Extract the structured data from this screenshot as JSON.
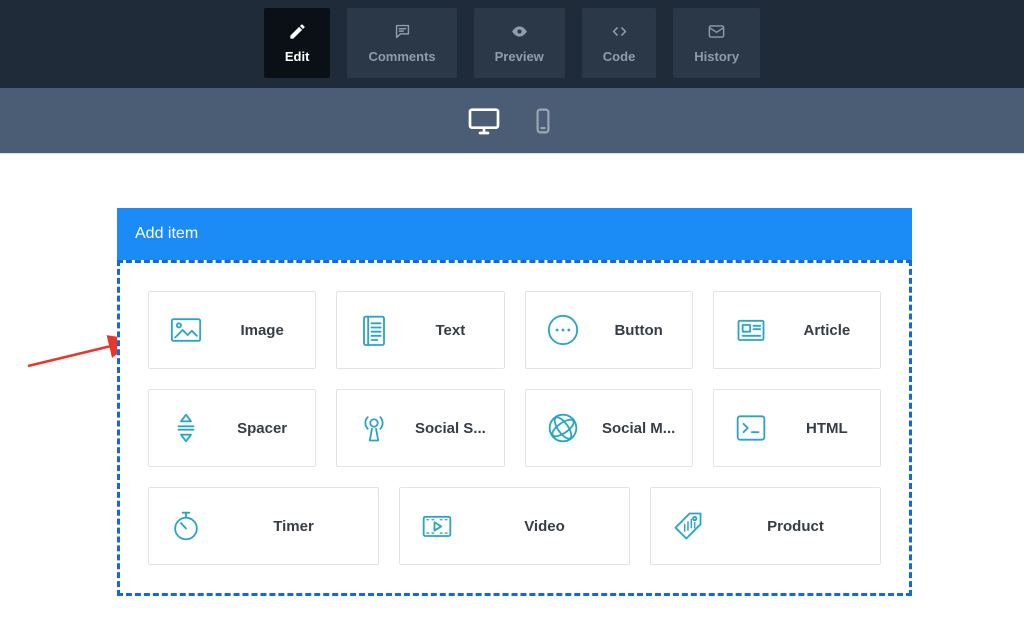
{
  "toolbar": {
    "tabs": [
      {
        "label": "Edit",
        "icon": "pencil-icon",
        "active": true
      },
      {
        "label": "Comments",
        "icon": "comments-icon",
        "active": false
      },
      {
        "label": "Preview",
        "icon": "eye-icon",
        "active": false
      },
      {
        "label": "Code",
        "icon": "code-icon",
        "active": false
      },
      {
        "label": "History",
        "icon": "history-icon",
        "active": false
      }
    ]
  },
  "device_bar": {
    "icons": [
      {
        "name": "desktop-icon",
        "active": true
      },
      {
        "name": "mobile-icon",
        "active": false
      }
    ]
  },
  "modal": {
    "title": "Add item",
    "items": [
      {
        "label": "Image",
        "icon": "image-icon"
      },
      {
        "label": "Text",
        "icon": "text-icon"
      },
      {
        "label": "Button",
        "icon": "button-icon"
      },
      {
        "label": "Article",
        "icon": "article-icon"
      },
      {
        "label": "Spacer",
        "icon": "spacer-icon"
      },
      {
        "label": "Social S...",
        "icon": "social-share-icon"
      },
      {
        "label": "Social M...",
        "icon": "social-media-icon"
      },
      {
        "label": "HTML",
        "icon": "html-icon"
      },
      {
        "label": "Timer",
        "icon": "timer-icon"
      },
      {
        "label": "Video",
        "icon": "video-icon"
      },
      {
        "label": "Product",
        "icon": "product-icon"
      }
    ]
  },
  "annotation": {
    "type": "red-arrow",
    "points_to": "Image",
    "color": "#e8362a"
  },
  "colors": {
    "topbar_bg": "#1f2b39",
    "tab_bg": "#2a3847",
    "tab_active_bg": "#0b1017",
    "tab_text": "#8f9dab",
    "tab_active_text": "#ffffff",
    "device_bar_bg": "#4a5d74",
    "modal_header_bg": "#1b8cf5",
    "dashed_border": "#1667d9",
    "card_icon": "#2aa5c4",
    "card_label": "#363d44",
    "arrow": "#e8362a"
  }
}
